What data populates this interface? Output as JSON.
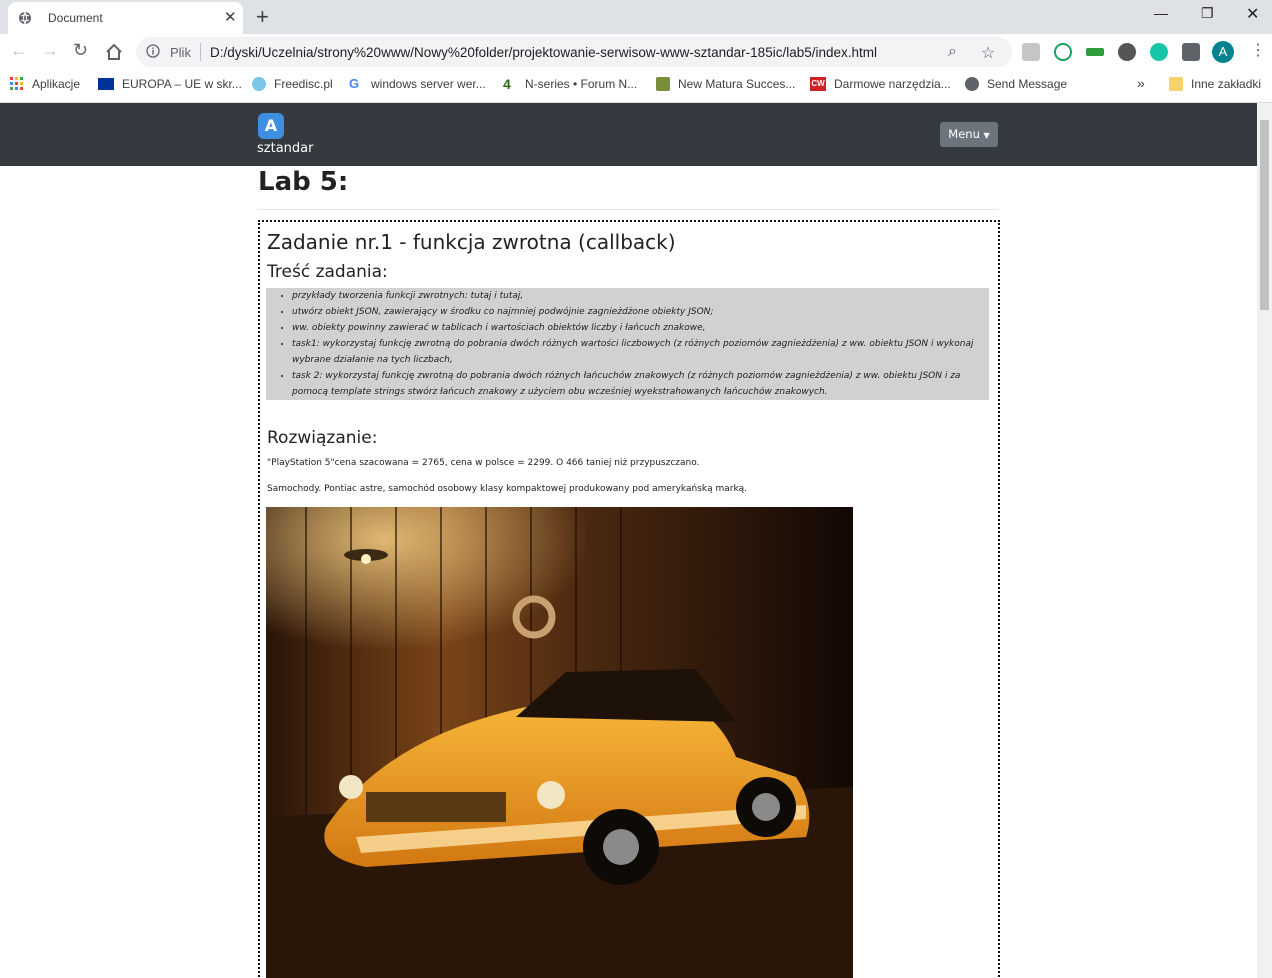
{
  "browser": {
    "tab_title": "Document",
    "address_prefix": "Plik",
    "url": "D:/dyski/Uczelnia/strony%20www/Nowy%20folder/projektowanie-serwisow-www-sztandar-185ic/lab5/index.html",
    "profile_initial": "A",
    "bookmarks": [
      {
        "label": "Aplikacje",
        "icon": "apps-grid-icon"
      },
      {
        "label": "EUROPA – UE w skr...",
        "icon": "eu-flag-icon"
      },
      {
        "label": "Freedisc.pl",
        "icon": "cloud-icon"
      },
      {
        "label": "windows server wer...",
        "icon": "google-icon"
      },
      {
        "label": "N-series • Forum N...",
        "icon": "four-icon"
      },
      {
        "label": "New Matura Succes...",
        "icon": "site-icon"
      },
      {
        "label": "Darmowe narzędzia...",
        "icon": "cw-icon"
      },
      {
        "label": "Send Message",
        "icon": "globe-icon"
      }
    ],
    "other_bookmarks": "Inne zakładki",
    "overflow": "»"
  },
  "navbar": {
    "logo_letter": "A",
    "brand": "sztandar",
    "menu_label": "Menu"
  },
  "page": {
    "title": "Lab 5:",
    "task": {
      "heading": "Zadanie nr.1 - funkcja zwrotna (callback)",
      "content_heading": "Treść zadania:",
      "items": [
        "przykłady tworzenia funkcji zwrotnych: tutaj i tutaj,",
        "utwórz obiekt JSON, zawierający w środku co najmniej podwójnie zagnieżdżone obiekty JSON;",
        "ww. obiekty powinny zawierać w tablicach i wartościach obiektów liczby i łańcuch znakowe,",
        "task1: wykorzystaj funkcję zwrotną do pobrania dwóch różnych wartości liczbowych (z różnych poziomów zagnieżdżenia) z ww. obiektu JSON i wykonaj wybrane działanie na tych liczbach,",
        "task 2: wykorzystaj funkcję zwrotną do pobrania dwóch różnych łańcuchów znakowych (z różnych poziomów zagnieżdżenia) z ww. obiektu JSON i za pomocą template strings stwórz łańcuch znakowy z użyciem obu wcześniej wyekstrahowanych łańcuchów znakowych."
      ],
      "solution_heading": "Rozwiązanie:",
      "solution_line1": "\"PlayStation 5\"cena szacowana = 2765, cena w polsce = 2299. O 466 taniej niż przypuszczano.",
      "solution_line2": "Samochody. Pontiac astre, samochód osobowy klasy kompaktowej produkowany pod amerykańską marką."
    }
  }
}
